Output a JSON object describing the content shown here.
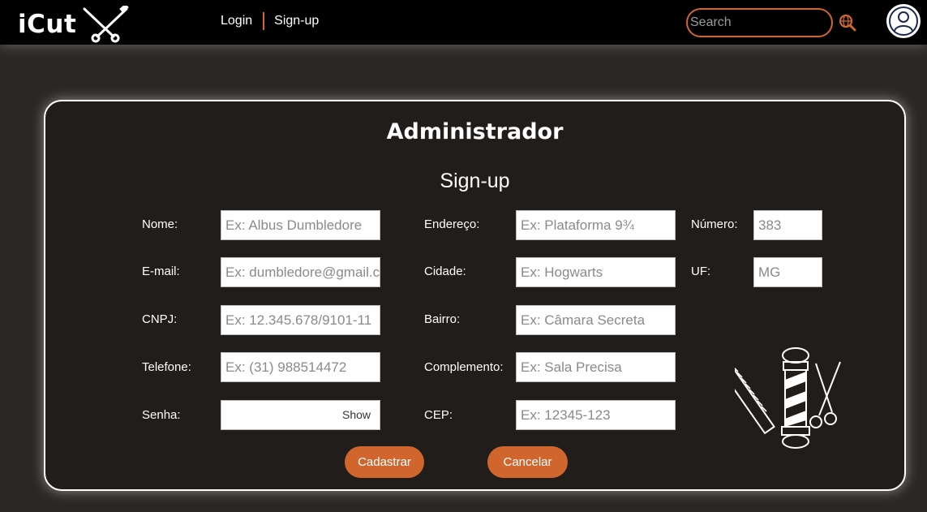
{
  "brand": {
    "name": "iCut"
  },
  "nav": {
    "login": "Login",
    "signup": "Sign-up"
  },
  "search": {
    "placeholder": "Search"
  },
  "icons": {
    "logo": "scissors-razor-icon",
    "search": "search-globe-icon",
    "avatar": "user-icon",
    "decor": "barber-pole-comb-scissors-icon"
  },
  "colors": {
    "accent": "#d0662e",
    "background": "#2b2725",
    "topbar": "#000000"
  },
  "form": {
    "title": "Administrador",
    "subtitle": "Sign-up",
    "fields": {
      "nome": {
        "label": "Nome:",
        "placeholder": "Ex: Albus Dumbledore"
      },
      "email": {
        "label": "E-mail:",
        "placeholder": "Ex: dumbledore@gmail.com"
      },
      "cnpj": {
        "label": "CNPJ:",
        "placeholder": "Ex: 12.345.678/9101-11"
      },
      "telefone": {
        "label": "Telefone:",
        "placeholder": "Ex: (31) 988514472"
      },
      "senha": {
        "label": "Senha:",
        "placeholder": "",
        "toggle": "Show"
      },
      "endereco": {
        "label": "Endereço:",
        "placeholder": "Ex: Plataforma 9¾"
      },
      "cidade": {
        "label": "Cidade:",
        "placeholder": "Ex: Hogwarts"
      },
      "bairro": {
        "label": "Bairro:",
        "placeholder": "Ex: Câmara Secreta"
      },
      "complemento": {
        "label": "Complemento:",
        "placeholder": "Ex: Sala Precisa"
      },
      "cep": {
        "label": "CEP:",
        "placeholder": "Ex: 12345-123"
      },
      "numero": {
        "label": "Número:",
        "placeholder": "383"
      },
      "uf": {
        "label": "UF:",
        "placeholder": "MG"
      }
    },
    "buttons": {
      "submit": "Cadastrar",
      "cancel": "Cancelar"
    }
  }
}
